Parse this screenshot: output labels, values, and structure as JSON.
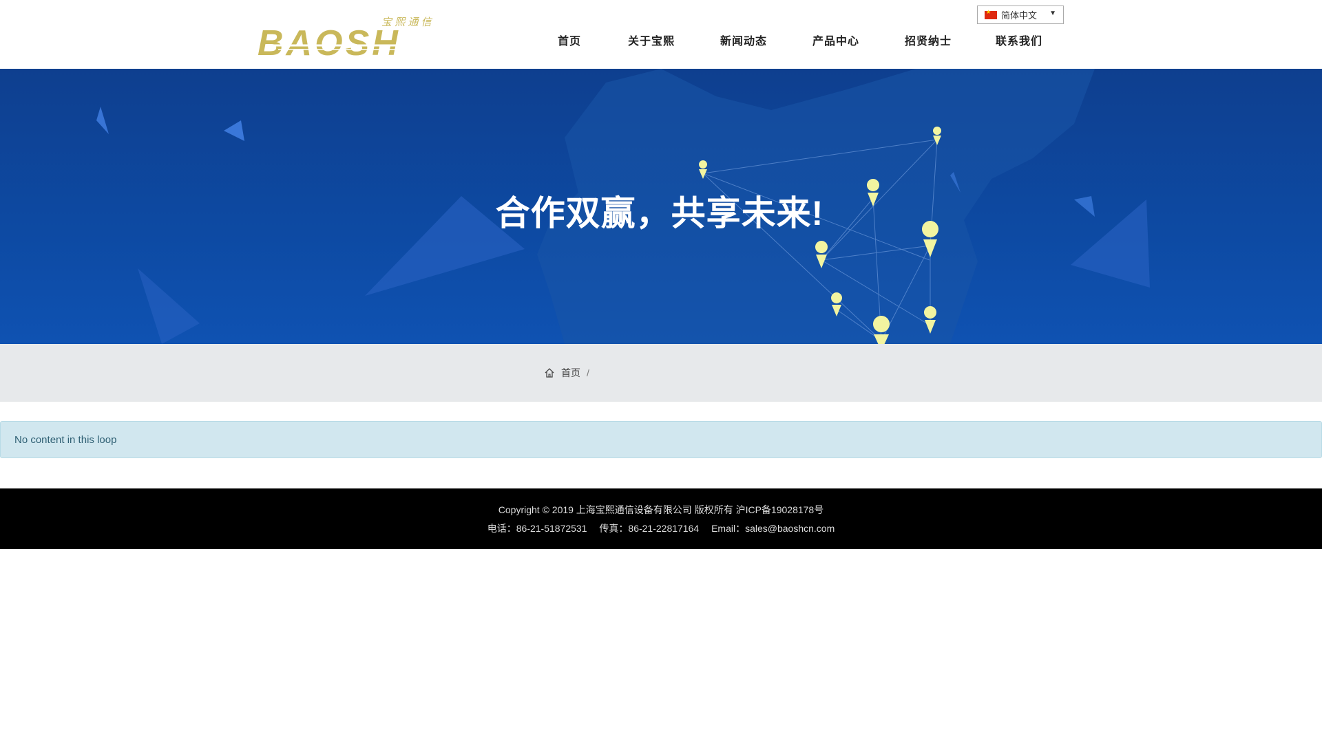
{
  "header": {
    "logo_text": "BAOSH",
    "logo_subtext": "宝 熙 通 信",
    "brand_color": "#c9b85a",
    "nav": [
      "首页",
      "关于宝熙",
      "新闻动态",
      "产品中心",
      "招贤纳士",
      "联系我们"
    ],
    "language": {
      "flag_icon": "china-flag-icon",
      "label": "简体中文",
      "arrow": "▼"
    }
  },
  "banner": {
    "title": "合作双赢，共享未来!",
    "background_color": "#0e4aa3",
    "marker_color": "#f2f4a0"
  },
  "breadcrumb": {
    "home_icon": "home-icon",
    "home_label": "首页",
    "separator": "/"
  },
  "alert": {
    "message": "No content in this loop",
    "background_color": "#d1e7ef"
  },
  "footer": {
    "copyright": "Copyright © 2019 上海宝熙通信设备有限公司 版权所有 沪ICP备19028178号",
    "phone": "电话：86-21-51872531",
    "fax": "传真：86-21-22817164",
    "email": "Email：sales@baoshcn.com"
  }
}
